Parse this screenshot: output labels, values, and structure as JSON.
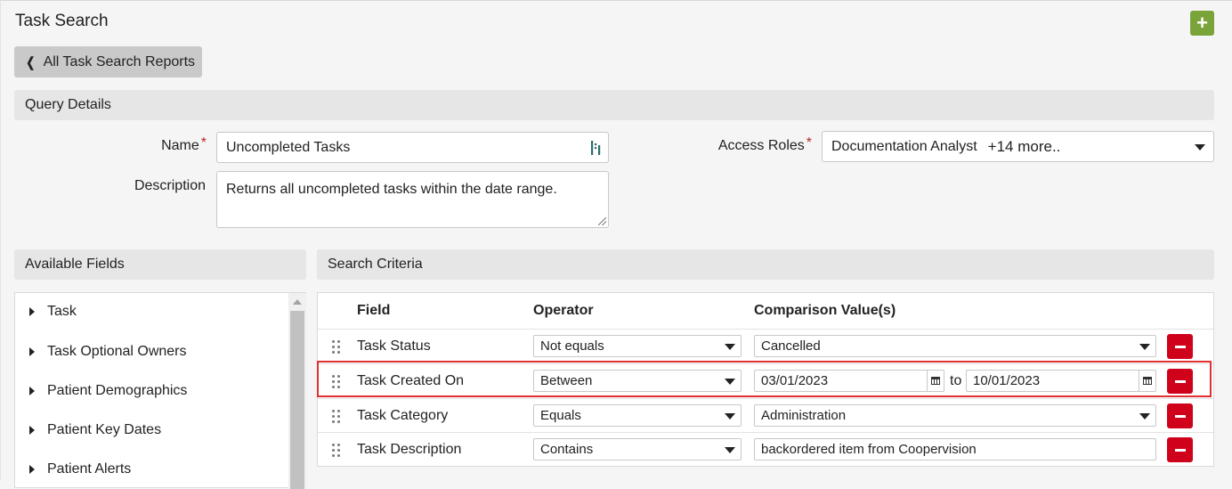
{
  "header": {
    "title": "Task Search",
    "add_icon": "plus-icon"
  },
  "back_button": {
    "label": "All Task Search Reports",
    "icon": "chevron-left-icon"
  },
  "query_details": {
    "section_title": "Query Details",
    "name_label": "Name",
    "required_mark": "*",
    "name_value": "Uncompleted Tasks",
    "description_label": "Description",
    "description_value": "Returns all uncompleted tasks within the date range.",
    "access_roles_label": "Access Roles",
    "access_roles_value": "Documentation Analyst",
    "access_roles_more": "+14 more.."
  },
  "available_fields": {
    "section_title": "Available Fields",
    "items": [
      {
        "label": "Task"
      },
      {
        "label": "Task Optional Owners"
      },
      {
        "label": "Patient Demographics"
      },
      {
        "label": "Patient Key Dates"
      },
      {
        "label": "Patient Alerts"
      }
    ]
  },
  "search_criteria": {
    "section_title": "Search Criteria",
    "columns": {
      "field": "Field",
      "operator": "Operator",
      "comparison": "Comparison Value(s)"
    },
    "rows": [
      {
        "field": "Task Status",
        "operator": "Not equals",
        "value": "Cancelled"
      },
      {
        "field": "Task Created On",
        "operator": "Between",
        "from": "03/01/2023",
        "to_label": "to",
        "to": "10/01/2023"
      },
      {
        "field": "Task Category",
        "operator": "Equals",
        "value": "Administration"
      },
      {
        "field": "Task Description",
        "operator": "Contains",
        "value": "backordered item from Coopervision"
      }
    ]
  },
  "colors": {
    "add": "#7aa43a",
    "remove": "#d0021b",
    "highlight": "#e03030",
    "required": "#b72b2b"
  }
}
